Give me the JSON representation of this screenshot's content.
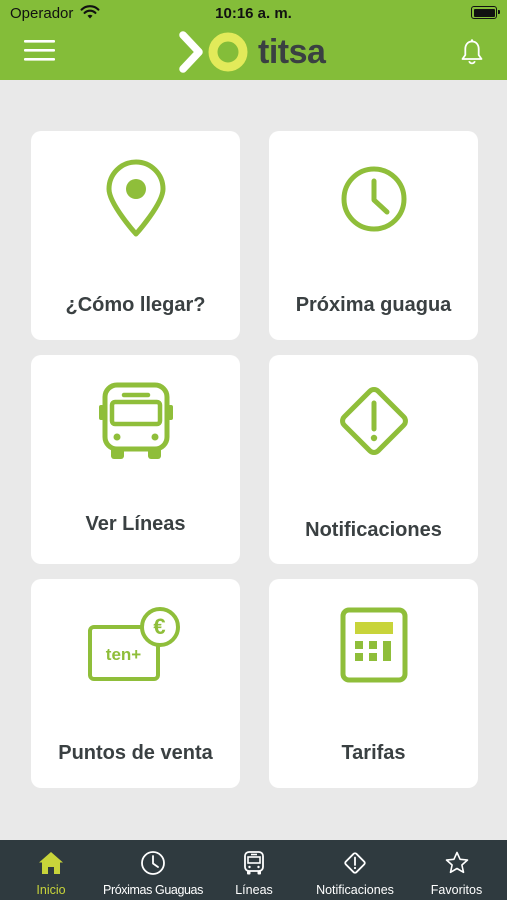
{
  "status_bar": {
    "carrier": "Operador",
    "time": "10:16 a. m."
  },
  "header": {
    "logo_text": "titsa",
    "brand_color": "#84bd39",
    "menu_icon": "hamburger-icon",
    "bell_icon": "bell-icon"
  },
  "tiles": [
    {
      "label": "¿Cómo llegar?",
      "icon": "map-pin-icon"
    },
    {
      "label": "Próxima guagua",
      "icon": "clock-icon"
    },
    {
      "label": "Ver Líneas",
      "icon": "bus-icon"
    },
    {
      "label": "Notificaciones",
      "icon": "warning-diamond-icon"
    },
    {
      "label": "Puntos de venta",
      "icon": "ticket-card-icon",
      "card_text": "ten+",
      "badge": "€"
    },
    {
      "label": "Tarifas",
      "icon": "calculator-icon"
    }
  ],
  "tabbar": {
    "background": "#2f3a3f",
    "active_color": "#c8d43a",
    "items": [
      {
        "label": "Inicio",
        "icon": "home-icon",
        "active": true
      },
      {
        "label": "Próximas Guaguas",
        "icon": "clock-icon",
        "active": false
      },
      {
        "label": "Líneas",
        "icon": "bus-icon",
        "active": false
      },
      {
        "label": "Notificaciones",
        "icon": "warning-diamond-icon",
        "active": false
      },
      {
        "label": "Favoritos",
        "icon": "star-icon",
        "active": false
      }
    ]
  }
}
